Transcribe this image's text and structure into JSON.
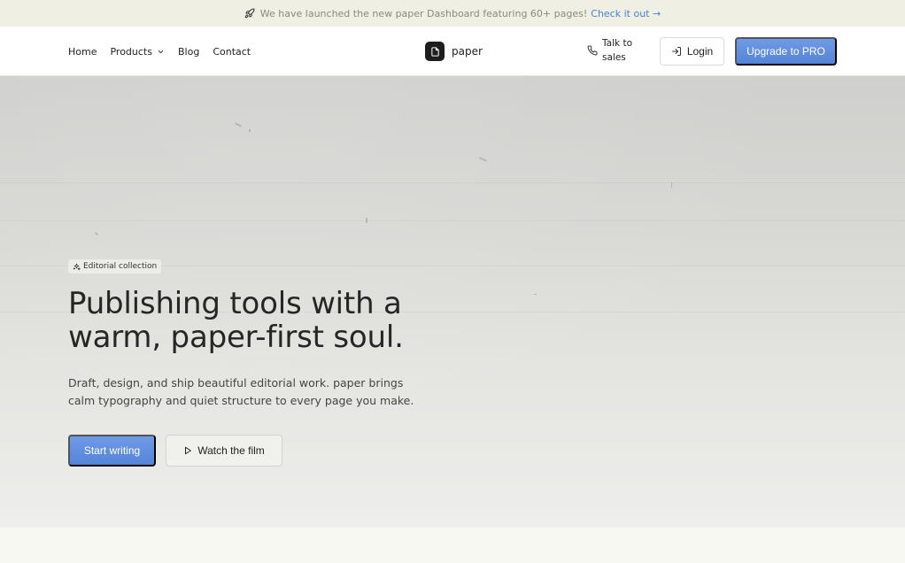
{
  "announcement": {
    "icon": "rocket-icon",
    "text": "We have launched the new paper Dashboard featuring 60+ pages!",
    "cta": "Check it out →"
  },
  "nav": {
    "links": [
      {
        "label": "Home"
      },
      {
        "label": "Products",
        "icon": "chevron-down-icon"
      },
      {
        "label": "Blog"
      },
      {
        "label": "Contact"
      }
    ],
    "brand": {
      "name": "paper",
      "icon": "document-icon"
    },
    "talk_to_sales": {
      "line1": "Talk to",
      "line2": "sales",
      "icon": "phone-icon"
    },
    "login": {
      "label": "Login",
      "icon": "login-icon"
    },
    "upgrade": {
      "label": "Upgrade to PRO"
    }
  },
  "hero": {
    "badge": {
      "label": "Editorial collection",
      "icon": "sparkles-icon"
    },
    "headline_line1": "Publishing tools with a",
    "headline_line2": "warm, paper-first soul.",
    "subtext_line1": "Draft, design, and ship beautiful editorial work. paper brings",
    "subtext_line2": "calm typography and quiet structure to every page you make.",
    "primary_button": "Start writing",
    "secondary_button": {
      "label": "Watch the film",
      "icon": "play-icon"
    }
  },
  "colors": {
    "accent": "#5a88da",
    "announcement_bg": "#efefe4",
    "link": "#4a82d9"
  }
}
